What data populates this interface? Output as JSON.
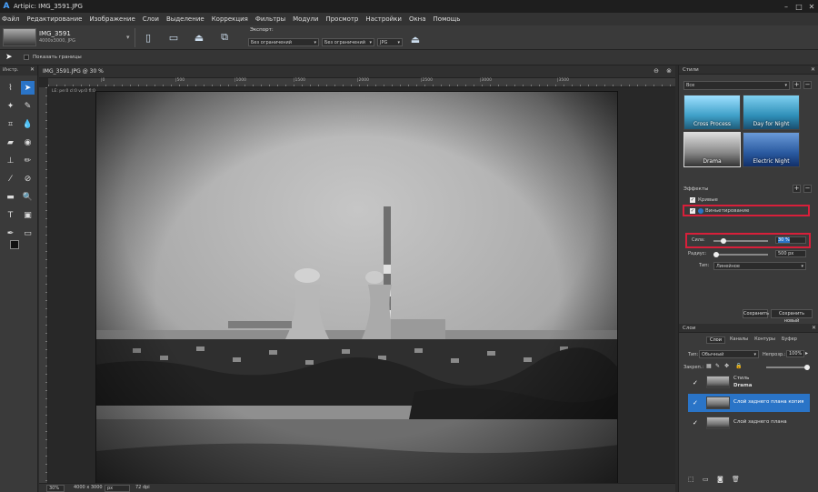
{
  "titlebar": {
    "title": "Artipic: IMG_3591.JPG"
  },
  "menu": [
    "Файл",
    "Редактирование",
    "Изображение",
    "Слои",
    "Выделение",
    "Коррекция",
    "Фильтры",
    "Модули",
    "Просмотр",
    "Настройки",
    "Окна",
    "Помощь"
  ],
  "options": {
    "file_name": "IMG_3591",
    "file_info": "4000x3000, JPG",
    "export_label": "Экспорт:",
    "select1": "Без ограничений",
    "select2": "Без ограничений",
    "format": "JPG"
  },
  "optrow2": {
    "show_borders": "Показать границы"
  },
  "toolbox": {
    "title": "Инстр."
  },
  "document": {
    "tab": "IMG_3591.JPG @ 30 %",
    "hint": "LE: pe:0 cl:0 vp:0 fl:0",
    "ruler_marks": [
      "|0",
      "|500",
      "|1000",
      "|1500",
      "|2000",
      "|2500",
      "|3000",
      "|3500"
    ]
  },
  "status": {
    "zoom": "30%",
    "size": "4000 x 3000",
    "unit": "px",
    "dpi": "72 dpi"
  },
  "styles_panel": {
    "title": "Стили",
    "filter": "Все",
    "presets": [
      {
        "name": "Cross Process",
        "color": "#3fa0c8"
      },
      {
        "name": "Day for Night",
        "color": "#2f8fb8"
      },
      {
        "name": "Drama",
        "color": "#888888"
      },
      {
        "name": "Electric Night",
        "color": "#2a5aa0"
      }
    ],
    "effects_label": "Эффекты",
    "effects": [
      "Кривые",
      "Виньетирование"
    ],
    "strength_label": "Сила:",
    "strength_value": "30 %",
    "radius_label": "Радиус:",
    "radius_value": "500 px",
    "type_label": "Тип:",
    "type_value": "Линейное",
    "save_button": "Сохранить",
    "save_new_button": "Сохранить новый"
  },
  "layers_panel": {
    "title": "Слои",
    "tabs": [
      "Слои",
      "Каналы",
      "Контуры",
      "Буфер"
    ],
    "blend_label": "Тип:",
    "blend_value": "Обычный",
    "opacity_label": "Непрозр.:",
    "opacity_value": "100%",
    "lock_label": "Закреп.:",
    "layers": [
      {
        "name": "Стиль",
        "sub": "Drama"
      },
      {
        "name": "Слой заднего плана копия",
        "sub": ""
      },
      {
        "name": "Слой заднего плана",
        "sub": ""
      }
    ]
  },
  "colors": {
    "accent": "#2a74c7",
    "highlight_red": "#d81f3a"
  }
}
